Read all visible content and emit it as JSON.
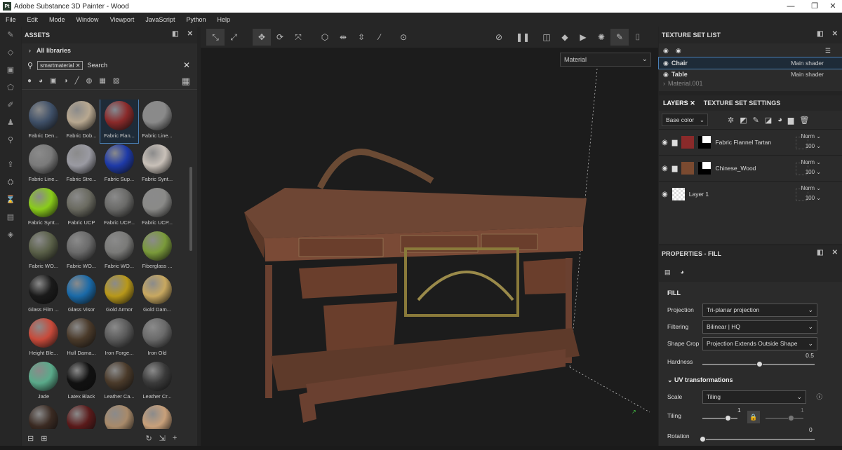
{
  "window": {
    "title": "Adobe Substance 3D Painter - Wood",
    "logo": "Pt"
  },
  "menu": [
    "File",
    "Edit",
    "Mode",
    "Window",
    "Viewport",
    "JavaScript",
    "Python",
    "Help"
  ],
  "assets": {
    "title": "ASSETS",
    "library": "All libraries",
    "search_tag": "smartmaterial",
    "search_placeholder": "Search",
    "items": [
      {
        "name": "Fabric Den...",
        "color": "#3f5068"
      },
      {
        "name": "Fabric Dob...",
        "color": "#b8a890"
      },
      {
        "name": "Fabric Flan...",
        "color": "#8a2a2a",
        "selected": true
      },
      {
        "name": "Fabric Line...",
        "color": "#8a8a8a"
      },
      {
        "name": "Fabric Line...",
        "color": "#7a7a7a"
      },
      {
        "name": "Fabric Stre...",
        "color": "#9a9aa2"
      },
      {
        "name": "Fabric Sup...",
        "color": "#1e3aa8"
      },
      {
        "name": "Fabric Synt...",
        "color": "#c8c0b8"
      },
      {
        "name": "Fabric Synt...",
        "color": "#8acc1a"
      },
      {
        "name": "Fabric UCP",
        "color": "#6a6a60"
      },
      {
        "name": "Fabric UCP...",
        "color": "#6a6a68"
      },
      {
        "name": "Fabric UCP...",
        "color": "#8a8a88"
      },
      {
        "name": "Fabric WO...",
        "color": "#5a6048"
      },
      {
        "name": "Fabric WO...",
        "color": "#6a6a6a"
      },
      {
        "name": "Fabric WO...",
        "color": "#7a7a78"
      },
      {
        "name": "Fiberglass ...",
        "color": "#7a9a3a"
      },
      {
        "name": "Glass Film ...",
        "color": "#1a1a1a"
      },
      {
        "name": "Glass Visor",
        "color": "#1a6aa8"
      },
      {
        "name": "Gold Armor",
        "color": "#b8981a"
      },
      {
        "name": "Gold Dam...",
        "color": "#c8a860"
      },
      {
        "name": "Height Ble...",
        "color": "#c84a3a"
      },
      {
        "name": "Hull Dama...",
        "color": "#4a3a2a"
      },
      {
        "name": "Iron Forge...",
        "color": "#5a5a5a"
      },
      {
        "name": "Iron Old",
        "color": "#6a6a6a"
      },
      {
        "name": "Jade",
        "color": "#5aaa8a"
      },
      {
        "name": "Latex Black",
        "color": "#111111"
      },
      {
        "name": "Leather Ca...",
        "color": "#4a3a2a"
      },
      {
        "name": "Leather Cr...",
        "color": "#3a3a3a"
      },
      {
        "name": "",
        "color": "#3a2a22"
      },
      {
        "name": "",
        "color": "#5a1a1a"
      },
      {
        "name": "",
        "color": "#a88a6a"
      },
      {
        "name": "",
        "color": "#c8a07a"
      }
    ]
  },
  "viewport": {
    "material_select": "Material"
  },
  "texture_set_list": {
    "title": "TEXTURE SET LIST",
    "items": [
      {
        "name": "Chair",
        "shader": "Main shader"
      },
      {
        "name": "Table",
        "shader": "Main shader"
      },
      {
        "name": "Material.001",
        "shader": ""
      }
    ]
  },
  "layers": {
    "tab_layers": "LAYERS",
    "tab_settings": "TEXTURE SET SETTINGS",
    "channel": "Base color",
    "rows": [
      {
        "name": "Fabric Flannel Tartan",
        "blend": "Norm",
        "opacity": "100",
        "color": "#8a2a2a"
      },
      {
        "name": "Chinese_Wood",
        "blend": "Norm",
        "opacity": "100",
        "color": "#7a4a30"
      },
      {
        "name": "Layer 1",
        "blend": "Norm",
        "opacity": "100",
        "color": "#cccccc"
      }
    ]
  },
  "properties": {
    "title": "PROPERTIES - FILL",
    "section": "FILL",
    "projection_label": "Projection",
    "projection": "Tri-planar projection",
    "filtering_label": "Filtering",
    "filtering": "Bilinear | HQ",
    "shapecrop_label": "Shape Crop",
    "shapecrop": "Projection Extends Outside Shape",
    "hardness_label": "Hardness",
    "hardness": "0.5",
    "uv_section": "UV transformations",
    "scale_label": "Scale",
    "scale": "Tiling",
    "tiling_label": "Tiling",
    "tiling": "1",
    "tiling2": "1",
    "rotation_label": "Rotation",
    "rotation": "0"
  }
}
